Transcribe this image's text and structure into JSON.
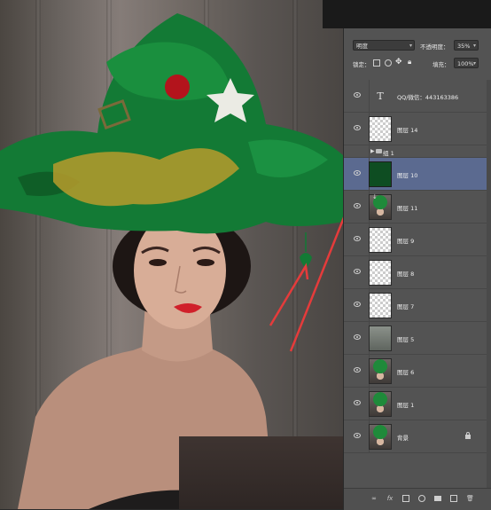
{
  "app": {
    "name": "Photoshop"
  },
  "layers_panel": {
    "blend_mode": "明度",
    "opacity_label": "不透明度：",
    "opacity_value": "35%",
    "lock_label": "锁定：",
    "fill_label": "填充：",
    "fill_value": "100%",
    "layers": [
      {
        "name": "QQ/微信：443163386",
        "thumb": "text",
        "thumb_glyph": "T",
        "visible": true
      },
      {
        "name": "图层 14",
        "thumb": "transparent",
        "visible": true
      },
      {
        "name": "组 1",
        "thumb": "group",
        "visible": false
      },
      {
        "name": "图层 10",
        "thumb": "green",
        "visible": true,
        "selected": true
      },
      {
        "name": "图层 11",
        "thumb": "photo",
        "visible": true,
        "linked_mask": true
      },
      {
        "name": "图层 9",
        "thumb": "transparent",
        "visible": true
      },
      {
        "name": "图层 8",
        "thumb": "transparent",
        "visible": true
      },
      {
        "name": "图层 7",
        "thumb": "transparent",
        "visible": true
      },
      {
        "name": "图层 5",
        "thumb": "gray",
        "visible": true
      },
      {
        "name": "图层 6",
        "thumb": "photo",
        "visible": true
      },
      {
        "name": "图层 1",
        "thumb": "photo",
        "visible": true
      },
      {
        "name": "背景",
        "thumb": "photo",
        "visible": true,
        "locked": true
      }
    ],
    "footer_icons": [
      "link-icon",
      "fx-icon",
      "mask-icon",
      "adjustment-icon",
      "group-folder-icon",
      "new-layer-icon",
      "trash-icon"
    ]
  },
  "colors": {
    "selected_row": "#5b6a90",
    "annotation_arrow": "#e53b3b",
    "layer10_fill": "#0e4d22"
  }
}
